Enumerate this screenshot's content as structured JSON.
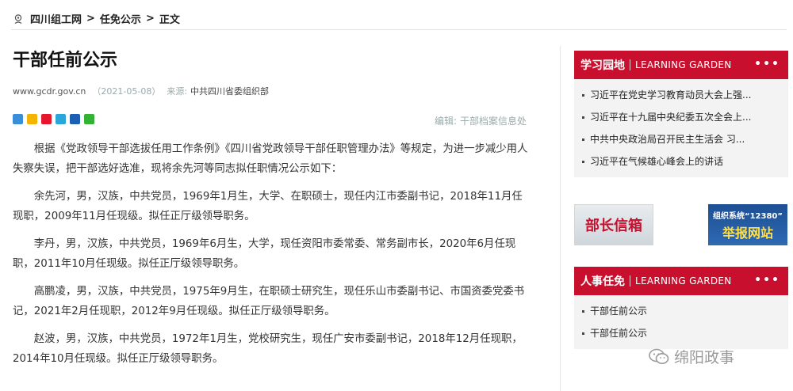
{
  "breadcrumb": {
    "items": [
      "四川组工网",
      "任免公示",
      "正文"
    ],
    "separator": ">"
  },
  "article": {
    "title": "干部任前公示",
    "site": "www.gcdr.gov.cn",
    "date": "（2021-05-08）",
    "source_label": "来源:",
    "source": "中共四川省委组织部",
    "editor_label": "编辑:",
    "editor": "干部档案信息处",
    "paragraphs": [
      "根据《党政领导干部选拔任用工作条例》《四川省党政领导干部任职管理办法》等规定，为进一步减少用人失察失误，把干部选好选准，现将余先河等同志拟任职情况公示如下：",
      "余先河，男，汉族，中共党员，1969年1月生，大学、在职硕士，现任内江市委副书记，2018年11月任现职，2009年11月任现级。拟任正厅级领导职务。",
      "李丹，男，汉族，中共党员，1969年6月生，大学，现任资阳市委常委、常务副市长，2020年6月任现职，2011年10月任现级。拟任正厅级领导职务。",
      "高鹏凌，男，汉族，中共党员，1975年9月生，在职硕士研究生，现任乐山市委副书记、市国资委党委书记，2021年2月任现职，2012年9月任现级。拟任正厅级领导职务。",
      "赵波，男，汉族，中共党员，1972年1月生，党校研究生，现任广安市委副书记，2018年12月任现职，2014年10月任现级。拟任正厅级领导职务。"
    ]
  },
  "share_icons": [
    {
      "name": "share-more-icon",
      "color": "#3b8fd9"
    },
    {
      "name": "qzone-icon",
      "color": "#f5b400"
    },
    {
      "name": "weibo-icon",
      "color": "#e6162d"
    },
    {
      "name": "tencent-weibo-icon",
      "color": "#2aa6da"
    },
    {
      "name": "renren-icon",
      "color": "#1d5fb3"
    },
    {
      "name": "wechat-icon",
      "color": "#34b233"
    }
  ],
  "sidebar": {
    "study": {
      "title": "学习园地",
      "subtitle": "LEARNING GARDEN",
      "more": "•••",
      "items": [
        "习近平在党史学习教育动员大会上强...",
        "习近平在十九届中央纪委五次全会上...",
        "中共中央政治局召开民主生活会 习...",
        "习近平在气候雄心峰会上的讲话"
      ]
    },
    "banners": {
      "left": "部长信箱",
      "right_top": "组织系统“12380”",
      "right_bottom": "举报网站"
    },
    "personnel": {
      "title": "人事任免",
      "subtitle": "LEARNING GARDEN",
      "more": "•••",
      "items": [
        "干部任前公示",
        "干部任前公示"
      ]
    }
  },
  "watermark": "绵阳政事",
  "colors": {
    "accent": "#c8102e",
    "banner_blue": "#1d4f93"
  }
}
